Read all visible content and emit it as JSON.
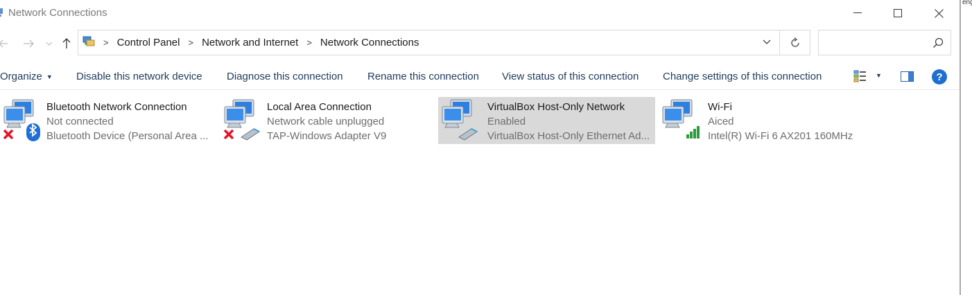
{
  "window": {
    "title": "Network Connections",
    "controls": {
      "minimize": "minimize",
      "maximize": "maximize",
      "close": "close"
    }
  },
  "right_strip_text": "eng",
  "address": {
    "crumbs": [
      "Control Panel",
      "Network and Internet",
      "Network Connections"
    ],
    "search_placeholder": ""
  },
  "commands": {
    "organize": "Organize",
    "disable": "Disable this network device",
    "diagnose": "Diagnose this connection",
    "rename": "Rename this connection",
    "view_status": "View status of this connection",
    "change_settings": "Change settings of this connection"
  },
  "connections": [
    {
      "name": "Bluetooth Network Connection",
      "status": "Not connected",
      "device": "Bluetooth Device (Personal Area ...",
      "icon": "bluetooth-adapter-icon",
      "selected": false
    },
    {
      "name": "Local Area Connection",
      "status": "Network cable unplugged",
      "device": "TAP-Windows Adapter V9",
      "icon": "ethernet-adapter-icon",
      "selected": false
    },
    {
      "name": "VirtualBox Host-Only Network",
      "status": "Enabled",
      "device": "VirtualBox Host-Only Ethernet Ad...",
      "icon": "ethernet-adapter-icon",
      "selected": true
    },
    {
      "name": "Wi-Fi",
      "status": "Aiced",
      "device": "Intel(R) Wi-Fi 6 AX201 160MHz",
      "icon": "wifi-adapter-icon",
      "selected": false
    }
  ],
  "colors": {
    "accent": "#1e6fd0",
    "selected_bg": "#d9d9d9",
    "command_text": "#1f3a5a",
    "error_red": "#e81123",
    "wifi_green": "#2e9b3e"
  }
}
